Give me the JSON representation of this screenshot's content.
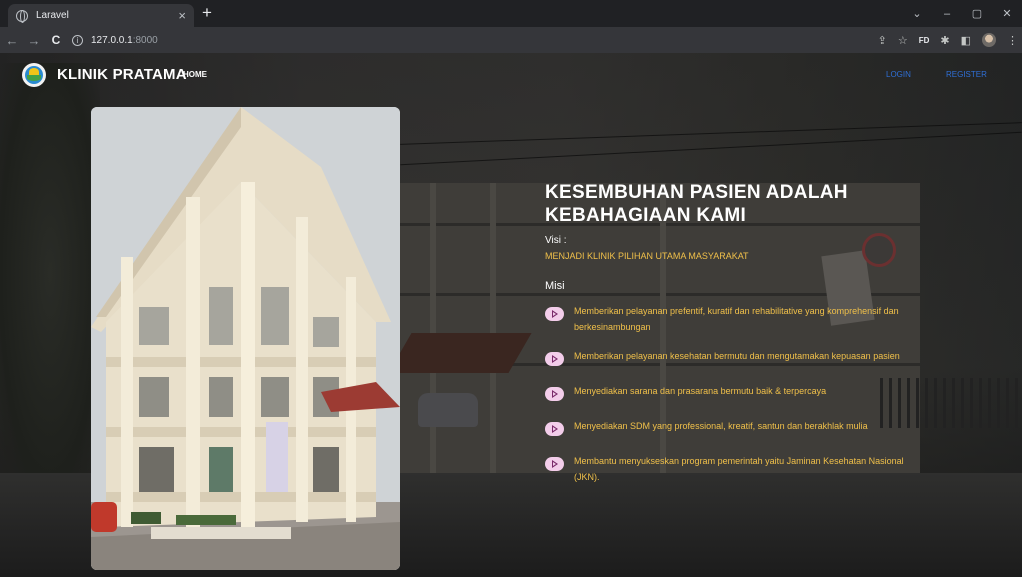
{
  "browser": {
    "tab_title": "Laravel",
    "tab_close": "×",
    "new_tab": "+",
    "url_host": "127.0.0.1",
    "url_port": ":8000",
    "window_controls": [
      "⌄",
      "–",
      "▢",
      "✕"
    ],
    "profile_badge": "FD"
  },
  "navbar": {
    "brand": "KLINIK PRATAMA",
    "home": "HOME",
    "login": "LOGIN",
    "register": "REGISTER"
  },
  "hero": {
    "title": "KESEMBUHAN PASIEN ADALAH KEBAHAGIAAN KAMI",
    "visi_label": "Visi :",
    "visi_text": "MENJADI KLINIK PILIHAN UTAMA MASYARAKAT",
    "misi_label": "Misi",
    "misi": [
      "Memberikan pelayanan prefentif, kuratif dan rehabilitative yang komprehensif dan berkesinambungan",
      "Memberikan pelayanan kesehatan bermutu dan mengutamakan kepuasan pasien",
      "Menyediakan sarana dan prasarana bermutu baik & terpercaya",
      "Menyediakan SDM yang professional, kreatif, santun dan berakhlak mulia",
      "Membantu menyukseskan program pemerintah yaitu Jaminan Kesehatan Nasional (JKN)."
    ]
  },
  "colors": {
    "accent_text": "#f0c04a",
    "link": "#2f6fd6",
    "bullet_bg": "#f3cdea"
  },
  "icons": [
    "globe-icon",
    "info-icon",
    "share-icon",
    "star-icon",
    "extensions-icon",
    "sidepanel-icon",
    "play-icon"
  ]
}
